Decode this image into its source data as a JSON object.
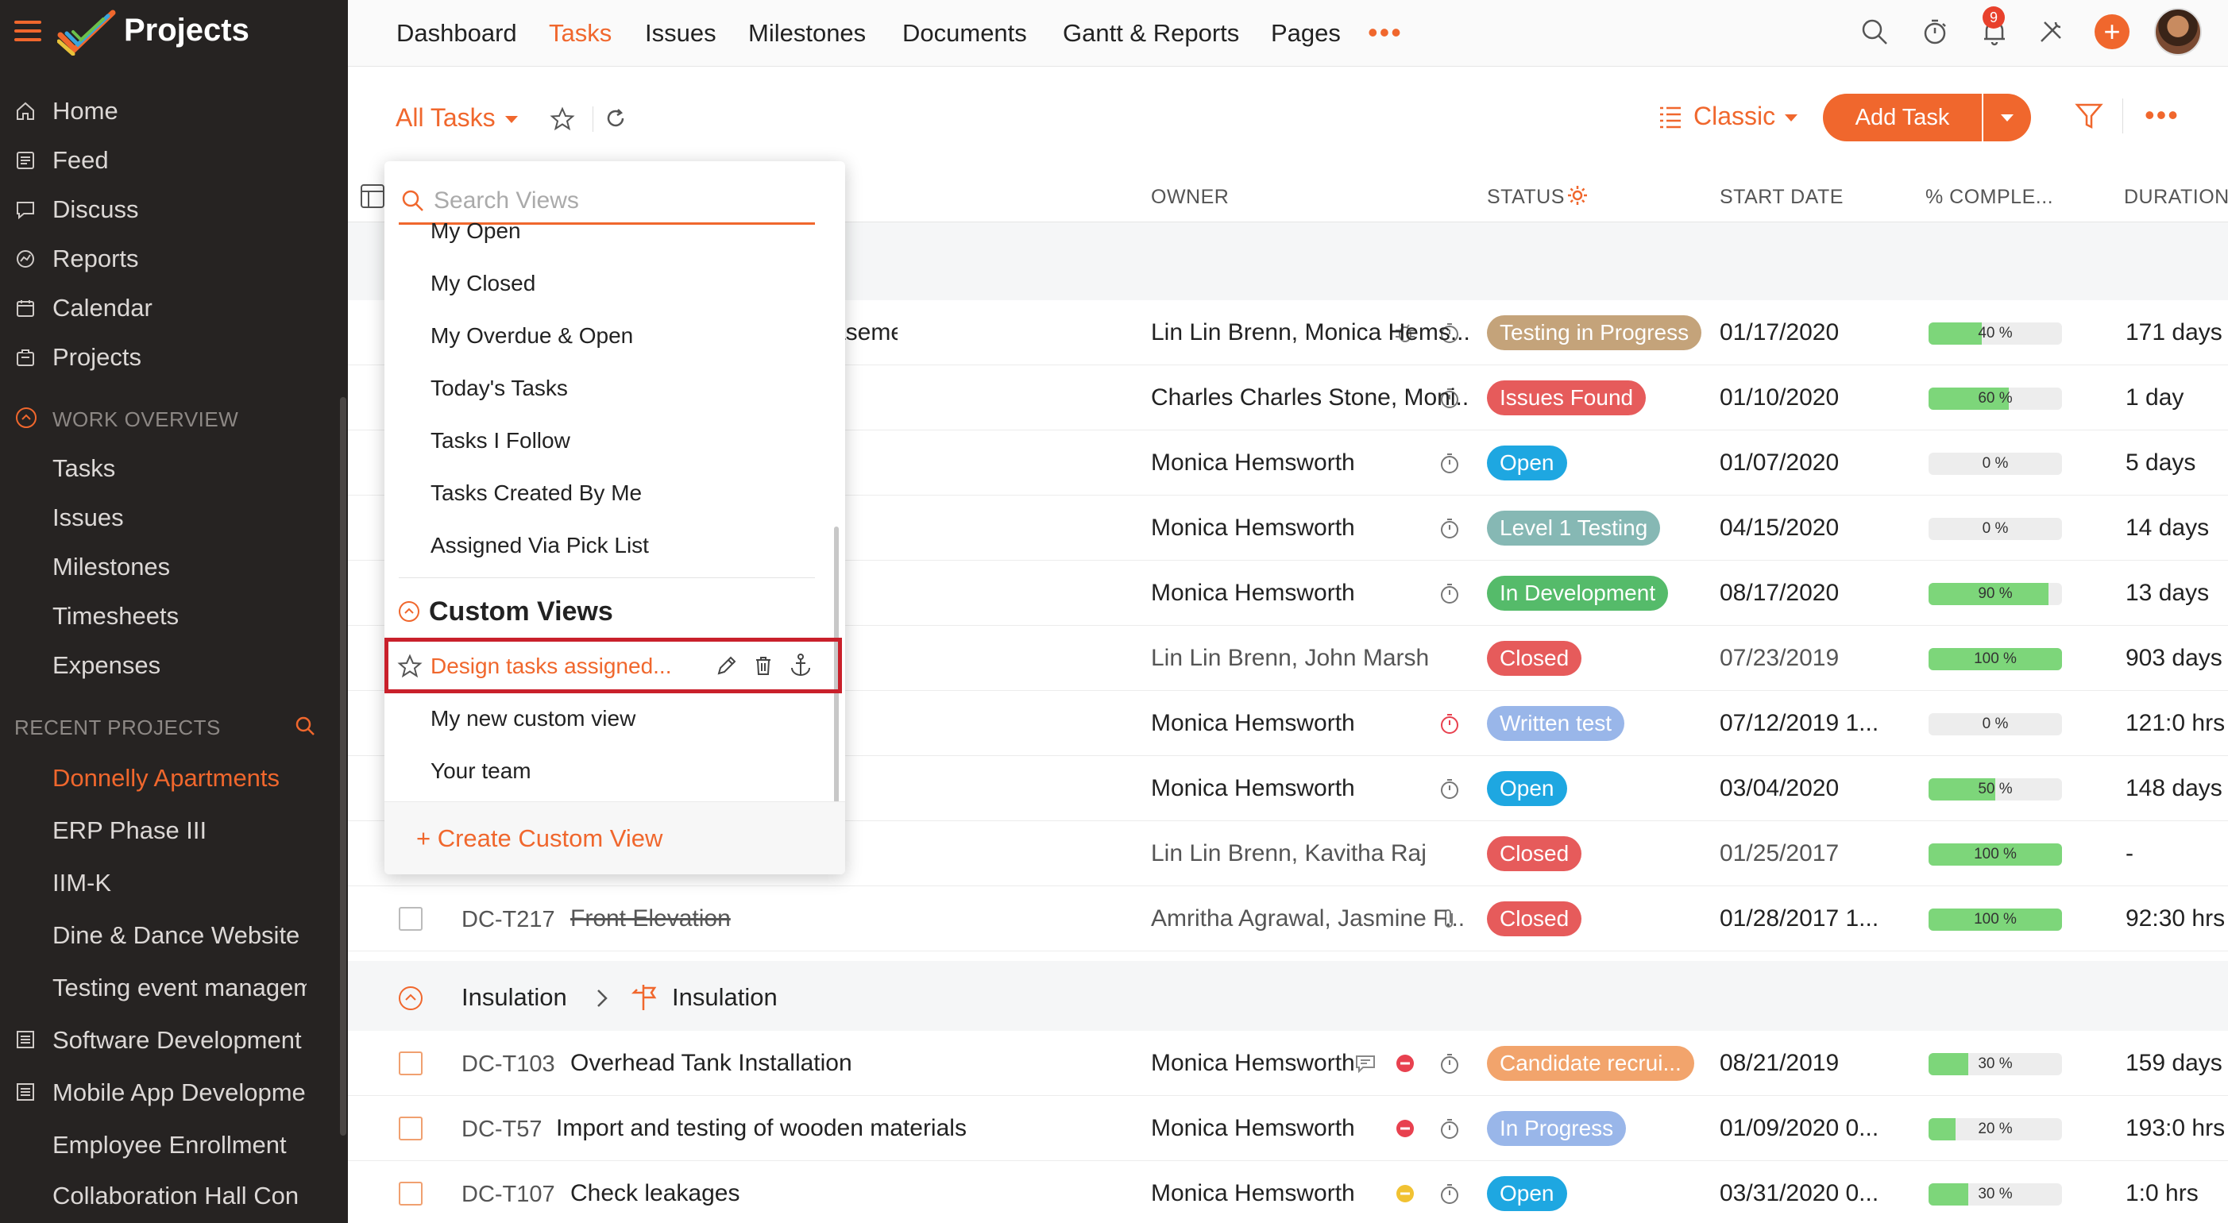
{
  "app": {
    "title": "Projects"
  },
  "sidebar": {
    "items": [
      {
        "label": "Home",
        "icon": "home-icon"
      },
      {
        "label": "Feed",
        "icon": "feed-icon"
      },
      {
        "label": "Discuss",
        "icon": "discuss-icon"
      },
      {
        "label": "Reports",
        "icon": "reports-icon"
      },
      {
        "label": "Calendar",
        "icon": "calendar-icon"
      },
      {
        "label": "Projects",
        "icon": "projects-icon"
      }
    ],
    "work_overview": {
      "title": "WORK OVERVIEW",
      "items": [
        "Tasks",
        "Issues",
        "Milestones",
        "Timesheets",
        "Expenses"
      ]
    },
    "recent_projects": {
      "title": "RECENT PROJECTS",
      "items": [
        "Donnelly Apartments",
        "ERP Phase III",
        "IIM-K",
        "Dine & Dance Website",
        "Testing event management"
      ],
      "icon_items": [
        "Software Development",
        "Mobile App Development"
      ],
      "more_items": [
        "Employee Enrollment",
        "Collaboration Hall Con"
      ]
    }
  },
  "topnav": {
    "items": [
      "Dashboard",
      "Tasks",
      "Issues",
      "Milestones",
      "Documents",
      "Gantt & Reports",
      "Pages"
    ],
    "active": "Tasks",
    "more": "•••",
    "notification_count": "9",
    "plus": "+"
  },
  "toolbar": {
    "view_label": "All Tasks",
    "layout_label": "Classic",
    "add_task_label": "Add Task",
    "more": "•••"
  },
  "table": {
    "headers": {
      "owner": "OWNER",
      "status": "STATUS",
      "start_date": "START DATE",
      "percent": "% COMPLE...",
      "duration": "DURATION"
    },
    "rows": [
      {
        "id": "",
        "name": "asement slab",
        "owner": "Lin Lin Brenn, Monica Hems...",
        "status": "Testing in Progress",
        "status_color": "#c4a37a",
        "start": "01/17/2020",
        "pct": 40,
        "pct_label": "40 %",
        "duration": "171 days"
      },
      {
        "id": "",
        "name": "",
        "owner": "Charles Charles Stone, Moni...",
        "status": "Issues Found",
        "status_color": "#e65b5b",
        "start": "01/10/2020",
        "pct": 60,
        "pct_label": "60 %",
        "duration": "1 day"
      },
      {
        "id": "",
        "name": "",
        "owner": "Monica Hemsworth",
        "status": "Open",
        "status_color": "#1ea7e1",
        "start": "01/07/2020",
        "pct": 0,
        "pct_label": "0 %",
        "duration": "5 days"
      },
      {
        "id": "",
        "name": "",
        "owner": "Monica Hemsworth",
        "status": "Level 1 Testing",
        "status_color": "#86b8b4",
        "start": "04/15/2020",
        "pct": 0,
        "pct_label": "0 %",
        "duration": "14 days"
      },
      {
        "id": "",
        "name": "",
        "owner": "Monica Hemsworth",
        "status": "In Development",
        "status_color": "#55bb6a",
        "start": "08/17/2020",
        "pct": 90,
        "pct_label": "90 %",
        "duration": "13 days"
      },
      {
        "id": "",
        "name": "",
        "owner": "Lin Lin Brenn, John Marsh",
        "status": "Closed",
        "status_color": "#e65b5b",
        "start": "07/23/2019",
        "pct": 100,
        "pct_label": "100 %",
        "duration": "903 days"
      },
      {
        "id": "",
        "name": "",
        "owner": "Monica Hemsworth",
        "status": "Written test",
        "status_color": "#99b6e9",
        "start": "07/12/2019 1...",
        "pct": 0,
        "pct_label": "0 %",
        "duration": "121:0 hrs"
      },
      {
        "id": "",
        "name": "",
        "owner": "Monica Hemsworth",
        "status": "Open",
        "status_color": "#1ea7e1",
        "start": "03/04/2020",
        "pct": 50,
        "pct_label": "50 %",
        "duration": "148 days"
      },
      {
        "id": "",
        "name": "",
        "owner": "Lin Lin Brenn, Kavitha Raj",
        "status": "Closed",
        "status_color": "#e65b5b",
        "start": "01/25/2017",
        "pct": 100,
        "pct_label": "100 %",
        "duration": "-"
      },
      {
        "id": "DC-T217",
        "name": "Front Elevation",
        "owner": "Amritha Agrawal, Jasmine F...",
        "status": "Closed",
        "status_color": "#e65b5b",
        "start": "01/28/2017 1...",
        "pct": 100,
        "pct_label": "100 %",
        "duration": "92:30 hrs"
      }
    ],
    "group": {
      "tasklist": "Insulation",
      "milestone": "Insulation"
    },
    "group_rows": [
      {
        "id": "DC-T103",
        "name": "Overhead Tank Installation",
        "owner": "Monica Hemsworth",
        "status": "Candidate recrui...",
        "status_color": "#f2a46c",
        "start": "08/21/2019",
        "pct": 30,
        "pct_label": "30 %",
        "duration": "159 days"
      },
      {
        "id": "DC-T57",
        "name": "Import and testing of wooden materials",
        "owner": "Monica Hemsworth",
        "status": "In Progress",
        "status_color": "#99b6e9",
        "start": "01/09/2020 0...",
        "pct": 20,
        "pct_label": "20 %",
        "duration": "193:0 hrs"
      },
      {
        "id": "DC-T107",
        "name": "Check leakages",
        "owner": "Monica Hemsworth",
        "status": "Open",
        "status_color": "#1ea7e1",
        "start": "03/31/2020 0...",
        "pct": 30,
        "pct_label": "30 %",
        "duration": "1:0 hrs"
      }
    ]
  },
  "views_dropdown": {
    "search_placeholder": "Search Views",
    "default_views": [
      "My Open",
      "My Closed",
      "My Overdue & Open",
      "Today's Tasks",
      "Tasks I Follow",
      "Tasks Created By Me",
      "Assigned Via Pick List"
    ],
    "custom_heading": "Custom Views",
    "custom_views": [
      "Design tasks assigned...",
      "My new custom view",
      "Your team"
    ],
    "create_label": "+ Create Custom View"
  },
  "colors": {
    "accent": "#f0672d",
    "sidebar_bg": "#262322",
    "highlight": "#c9202b"
  }
}
